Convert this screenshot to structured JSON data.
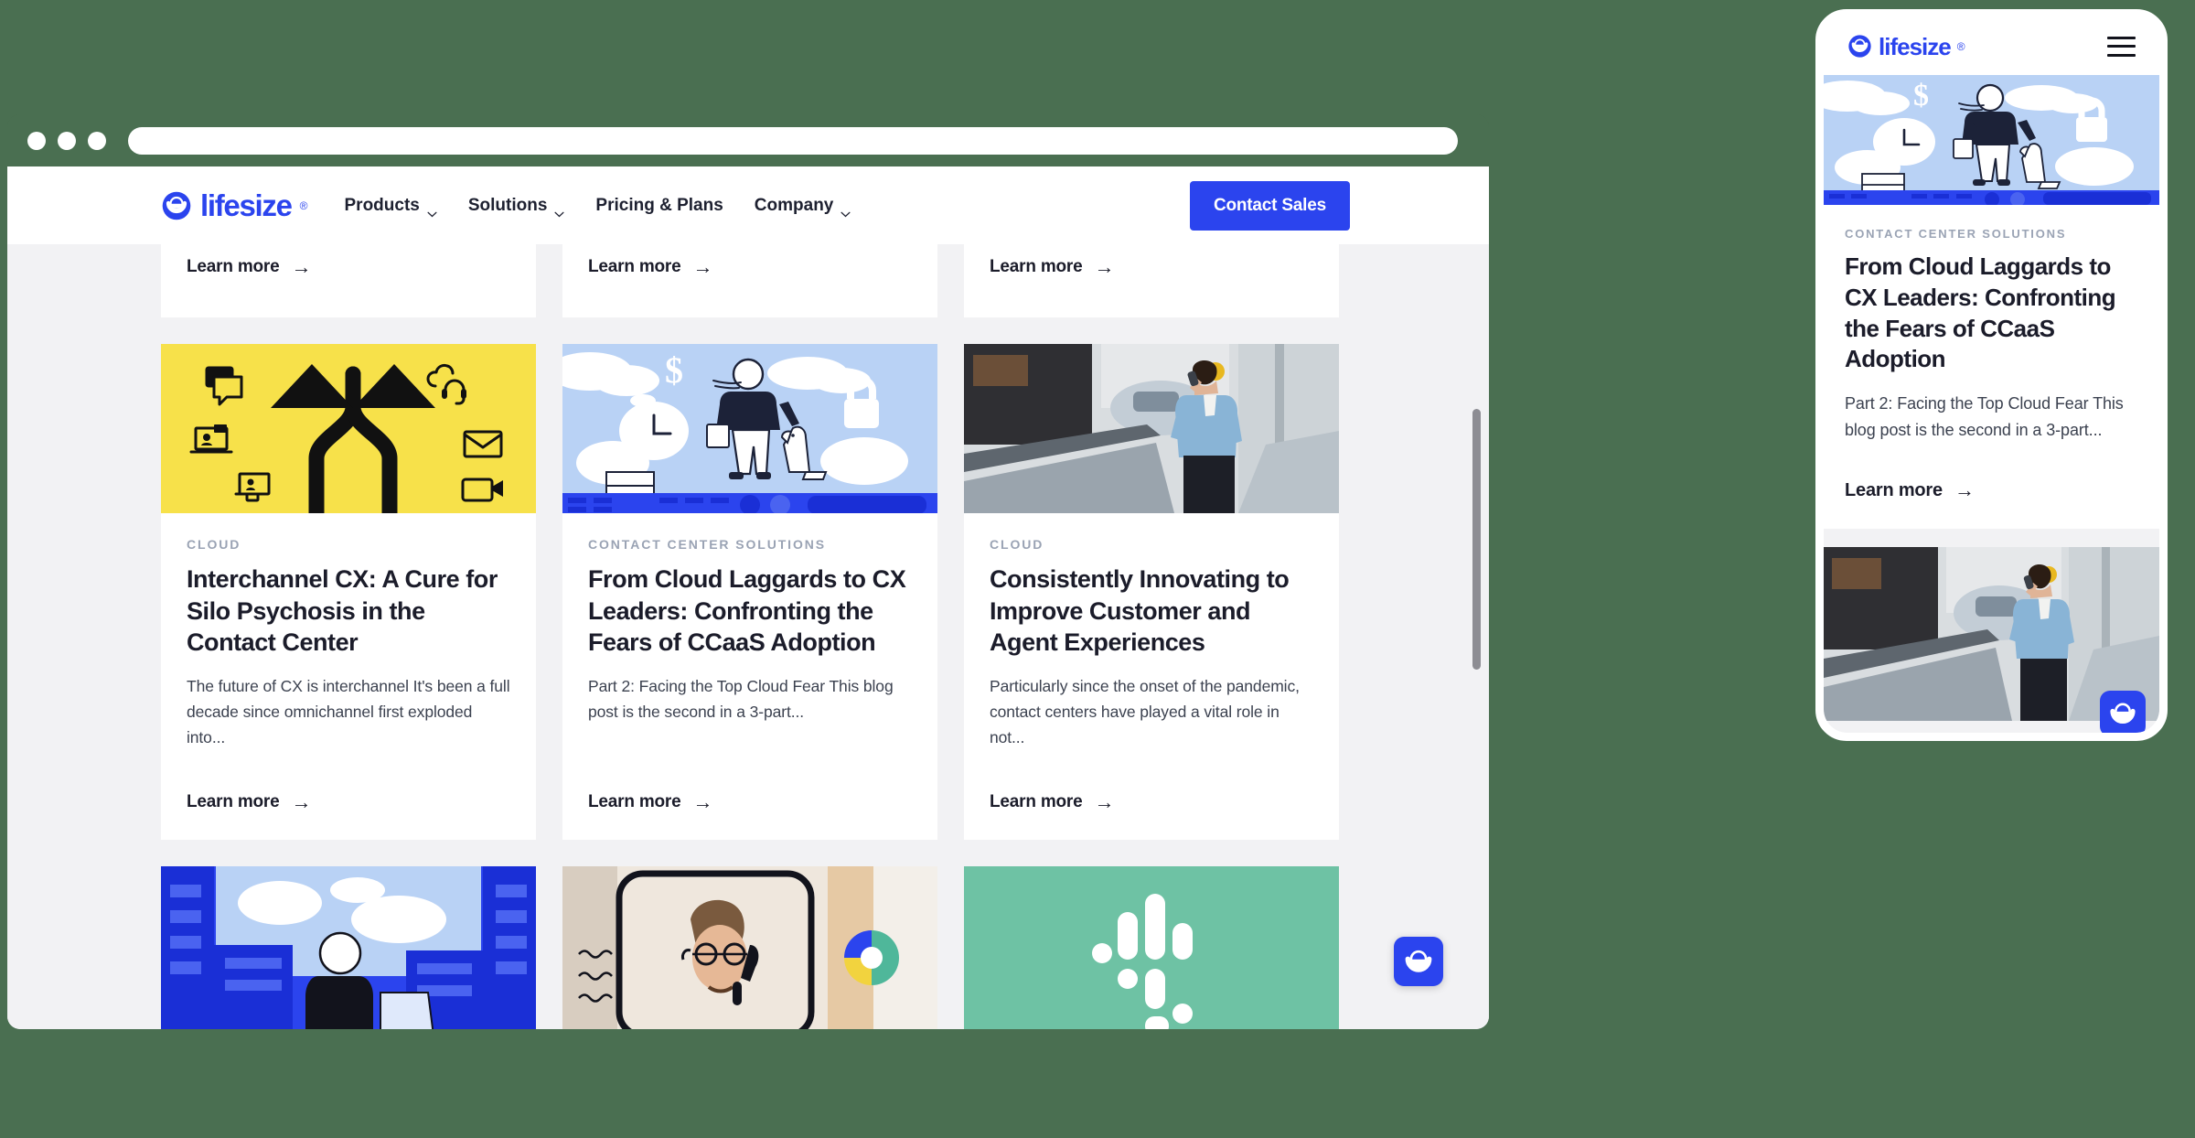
{
  "theme": {
    "page_background": "#4a6f51",
    "brand_blue": "#2b44ee",
    "text_dark": "#1b1c2a",
    "category_gray": "#9aa3b4",
    "card_bg": "#ffffff",
    "surface_gray": "#f2f2f4",
    "yellow_card": "#f7e14a",
    "teal_card": "#6ec2a4",
    "sky_blue": "#b9d2f5"
  },
  "browser": {
    "window_dots": [
      "dot-1",
      "dot-2",
      "dot-3"
    ],
    "url_value": "",
    "url_placeholder": ""
  },
  "header": {
    "brand_name": "lifesize",
    "brand_registered": "®",
    "nav": [
      {
        "label": "Products",
        "has_dropdown": true
      },
      {
        "label": "Solutions",
        "has_dropdown": true
      },
      {
        "label": "Pricing & Plans",
        "has_dropdown": false
      },
      {
        "label": "Company",
        "has_dropdown": true
      }
    ],
    "cta_label": "Contact Sales"
  },
  "learn_more_label": "Learn more",
  "arrow_glyph": "→",
  "cards_top_partial": [
    {
      "learn_more": "Learn more"
    },
    {
      "learn_more": "Learn more"
    },
    {
      "learn_more": "Learn more"
    }
  ],
  "cards_main": [
    {
      "category": "CLOUD",
      "title": "Interchannel CX: A Cure for Silo Psychosis in the Contact Center",
      "excerpt": "The future of CX is interchannel It's been a full decade since omnichannel first exploded into...",
      "learn_more": "Learn more",
      "media": "illustration-yellow-crossing-arrows-channels"
    },
    {
      "category": "CONTACT CENTER SOLUTIONS",
      "title": "From Cloud Laggards to CX Leaders: Confronting the Fears of CCaaS Adoption",
      "excerpt": "Part 2: Facing the Top Cloud Fear This blog post is the second in a 3-part...",
      "learn_more": "Learn more",
      "media": "illustration-person-with-dog-clouds-lock-clock-dollar"
    },
    {
      "category": "CLOUD",
      "title": "Consistently Innovating to Improve Customer and Agent Experiences",
      "excerpt": "Particularly since the onset of the pandemic, contact centers have played a vital role in not...",
      "learn_more": "Learn more",
      "media": "photo-man-on-escalator-with-phone"
    }
  ],
  "cards_bottom_partial": [
    {
      "media": "illustration-blue-city-person-with-paper"
    },
    {
      "media": "photo-man-headset-video-call-with-pie-logo"
    },
    {
      "media": "illustration-teal-slack-logo"
    }
  ],
  "chat_widget": {
    "icon": "lifesize-logo-icon",
    "label": "Open chat"
  },
  "mobile": {
    "brand_name": "lifesize",
    "menu_icon": "hamburger-menu-icon",
    "hero_media": "illustration-person-with-dog-clouds-lock-clock-dollar",
    "card": {
      "category": "CONTACT CENTER SOLUTIONS",
      "title": "From Cloud Laggards to CX Leaders: Confronting the Fears of CCaaS Adoption",
      "excerpt": "Part 2: Facing the Top Cloud Fear This blog post is the second in a 3-part...",
      "learn_more": "Learn more"
    },
    "next_media": "photo-man-on-escalator-with-phone",
    "chat_widget": {
      "icon": "lifesize-logo-icon"
    }
  }
}
